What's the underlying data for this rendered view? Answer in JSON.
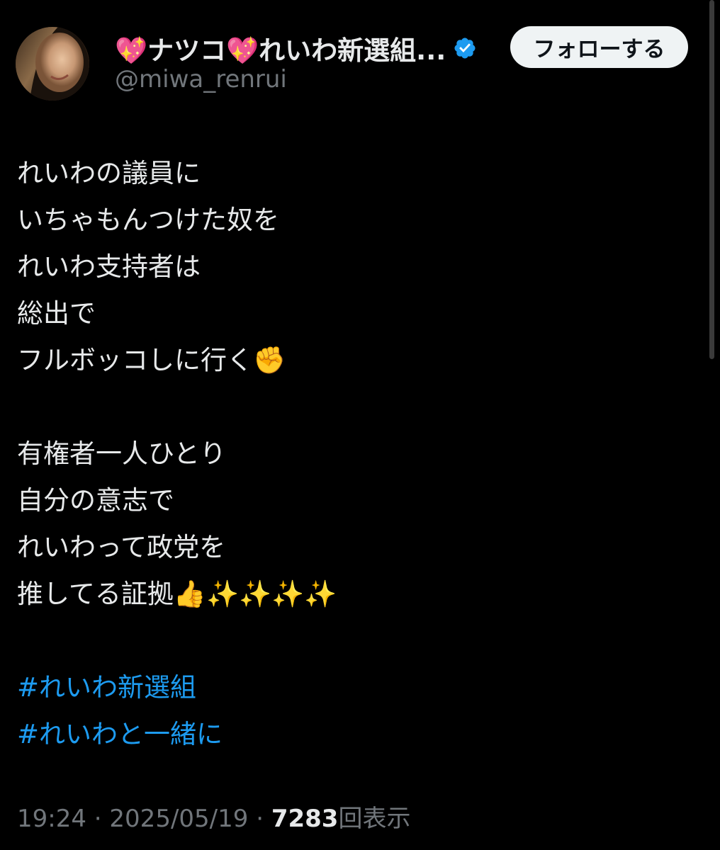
{
  "author": {
    "display_name": "💖ナツコ💖れいわ新選組...",
    "handle": "@miwa_renrui",
    "verified_icon": "verified-badge-icon",
    "verified_color": "#1d9bf0"
  },
  "follow_button": {
    "label": "フォローする"
  },
  "tweet": {
    "lines": [
      "れいわの議員に",
      "いちゃもんつけた奴を",
      "れいわ支持者は",
      "総出で",
      "フルボッコしに行く✊",
      "有権者一人ひとり",
      "自分の意志で",
      "れいわって政党を",
      "推してる証拠👍✨✨✨✨"
    ],
    "hashtags": [
      "#れいわ新選組",
      "#れいわと一緒に"
    ]
  },
  "meta": {
    "time": "19:24",
    "separator": "·",
    "date": "2025/05/19",
    "views_count": "7283",
    "views_label": "回表示"
  },
  "colors": {
    "background": "#000000",
    "text": "#e7e9ea",
    "secondary": "#71767b",
    "link": "#1d9bf0"
  }
}
